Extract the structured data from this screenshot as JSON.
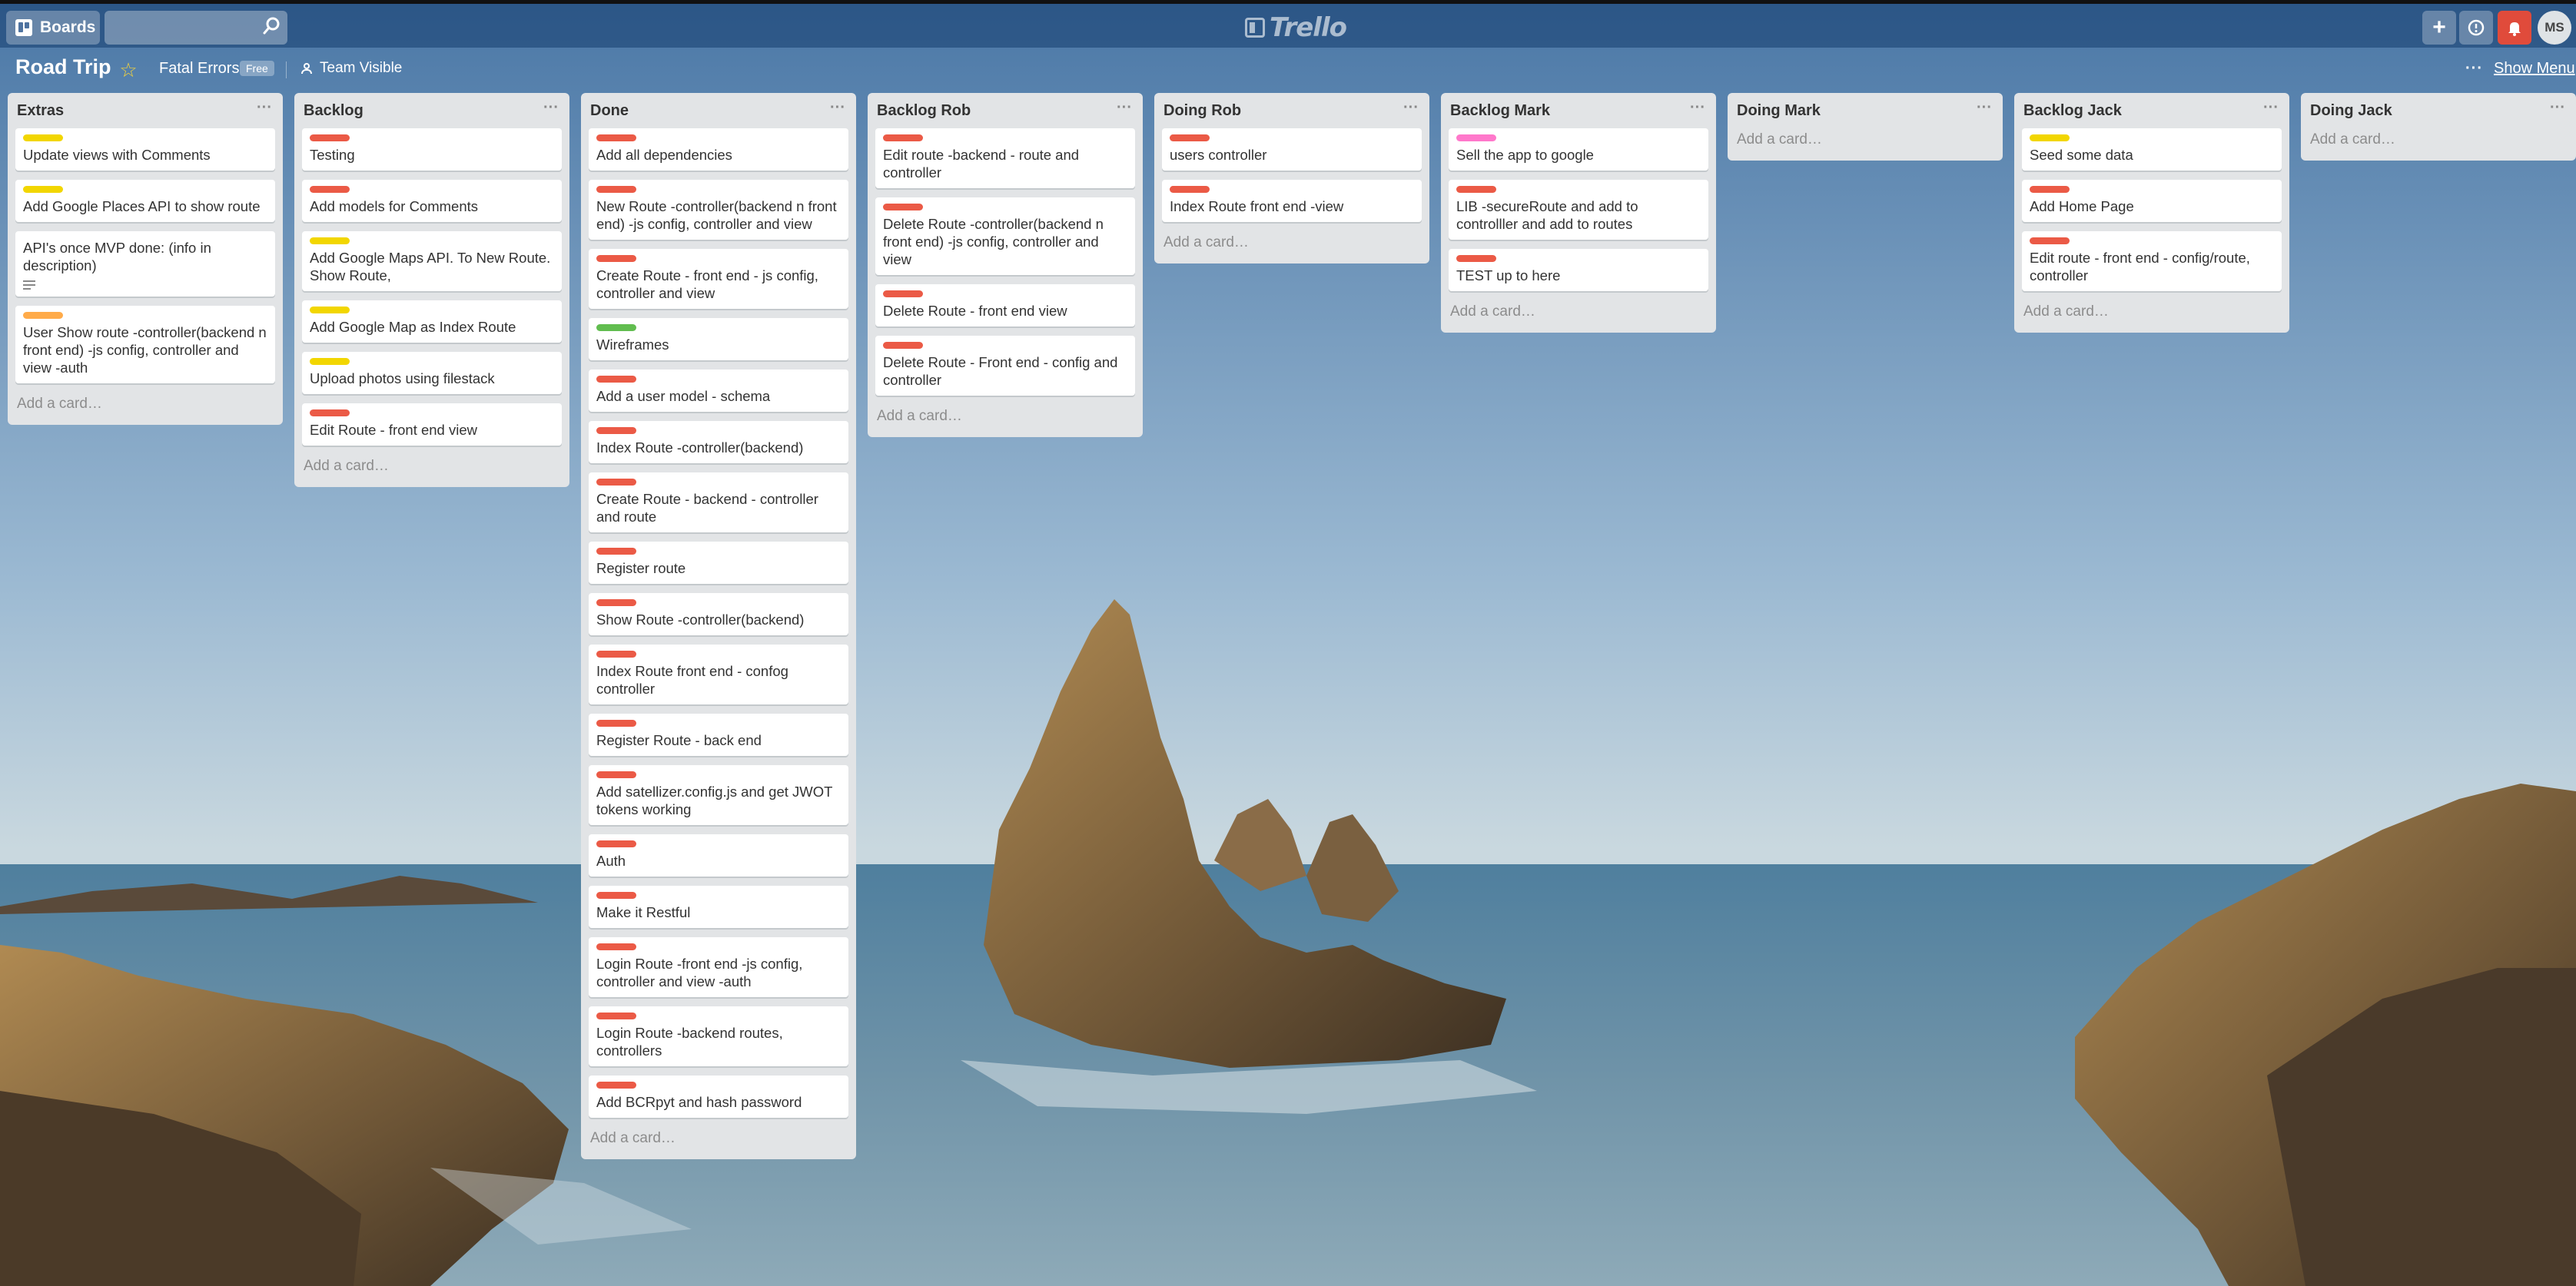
{
  "colors": {
    "red": "#eb5a46",
    "yellow": "#f2d600",
    "orange": "#ffab4a",
    "green": "#61bd4f",
    "pink": "#ff78cb"
  },
  "header": {
    "boards_label": "Boards",
    "search_value": "",
    "logo_text": "Trello",
    "avatar_initials": "MS"
  },
  "board": {
    "title": "Road Trip",
    "team": "Fatal Errors",
    "team_badge": "Free",
    "visibility": "Team Visible",
    "menu_dots": "···",
    "show_menu": "Show Menu"
  },
  "add_card": "Add a card…",
  "lists": [
    {
      "title": "Extras",
      "cards": [
        {
          "label": "yellow",
          "title": "Update views with Comments"
        },
        {
          "label": "yellow",
          "title": "Add Google Places API to show route"
        },
        {
          "label": "",
          "title": "API's once MVP done: (info in description)",
          "desc_icon": "description-icon"
        },
        {
          "label": "orange",
          "title": "User Show route -controller(backend n front end) -js config, controller and view -auth"
        }
      ]
    },
    {
      "title": "Backlog",
      "cards": [
        {
          "label": "red",
          "title": "Testing"
        },
        {
          "label": "red",
          "title": "Add models for Comments"
        },
        {
          "label": "yellow",
          "title": "Add Google Maps API. To New Route. Show Route,"
        },
        {
          "label": "yellow",
          "title": "Add Google Map as Index Route"
        },
        {
          "label": "yellow",
          "title": "Upload photos using filestack"
        },
        {
          "label": "red",
          "title": "Edit Route - front end view"
        }
      ]
    },
    {
      "title": "Done",
      "cards": [
        {
          "label": "red",
          "title": "Add all dependencies"
        },
        {
          "label": "red",
          "title": "New Route -controller(backend n front end) -js config, controller and view"
        },
        {
          "label": "red",
          "title": "Create Route - front end - js config, controller and view"
        },
        {
          "label": "green",
          "title": "Wireframes"
        },
        {
          "label": "red",
          "title": "Add a user model - schema"
        },
        {
          "label": "red",
          "title": "Index Route -controller(backend)"
        },
        {
          "label": "red",
          "title": "Create Route - backend - controller and route"
        },
        {
          "label": "red",
          "title": "Register route"
        },
        {
          "label": "red",
          "title": "Show Route -controller(backend)"
        },
        {
          "label": "red",
          "title": "Index Route front end - confog controller"
        },
        {
          "label": "red",
          "title": "Register Route - back end"
        },
        {
          "label": "red",
          "title": "Add satellizer.config.js and get JWOT tokens working"
        },
        {
          "label": "red",
          "title": "Auth"
        },
        {
          "label": "red",
          "title": "Make it Restful"
        },
        {
          "label": "red",
          "title": "Login Route -front end -js config, controller and view -auth"
        },
        {
          "label": "red",
          "title": "Login Route -backend routes, controllers"
        },
        {
          "label": "red",
          "title": "Add BCRpyt and hash password"
        }
      ]
    },
    {
      "title": "Backlog Rob",
      "cards": [
        {
          "label": "red",
          "title": "Edit route -backend - route and controller"
        },
        {
          "label": "red",
          "title": "Delete Route -controller(backend n front end) -js config, controller and view"
        },
        {
          "label": "red",
          "title": "Delete Route - front end view"
        },
        {
          "label": "red",
          "title": "Delete Route - Front end - config and controller"
        }
      ]
    },
    {
      "title": "Doing Rob",
      "cards": [
        {
          "label": "red",
          "title": "users controller"
        },
        {
          "label": "red",
          "title": "Index Route front end -view"
        }
      ]
    },
    {
      "title": "Backlog Mark",
      "cards": [
        {
          "label": "pink",
          "title": "Sell the app to google"
        },
        {
          "label": "red",
          "title": "LIB -secureRoute and add to controlller and add to routes"
        },
        {
          "label": "red",
          "title": "TEST up to here"
        }
      ]
    },
    {
      "title": "Doing Mark",
      "cards": []
    },
    {
      "title": "Backlog Jack",
      "cards": [
        {
          "label": "yellow",
          "title": "Seed some data"
        },
        {
          "label": "red",
          "title": "Add Home Page"
        },
        {
          "label": "red",
          "title": "Edit route - front end - config/route, controller"
        }
      ]
    },
    {
      "title": "Doing Jack",
      "cards": []
    }
  ]
}
